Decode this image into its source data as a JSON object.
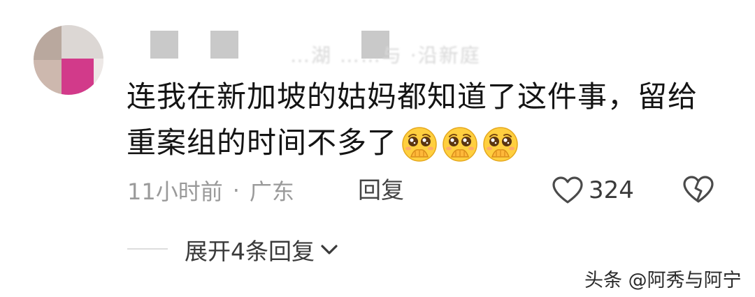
{
  "comment": {
    "author_partial": "…湖 ……与 ·沿新庭",
    "text": "连我在新加坡的姑妈都知道了这件事，留给重案组的时间不多了",
    "emojis": [
      "pleading-face-icon",
      "pleading-face-icon",
      "pleading-face-icon"
    ],
    "time": "11小时前",
    "separator": "·",
    "location": "广东",
    "reply_label": "回复",
    "like_count": "324",
    "expand_label": "展开4条回复"
  },
  "watermark": "头条 @阿秀与阿宁",
  "colors": {
    "meta_gray": "#9a9a9a",
    "emoji_yellow": "#ffcf3f"
  }
}
